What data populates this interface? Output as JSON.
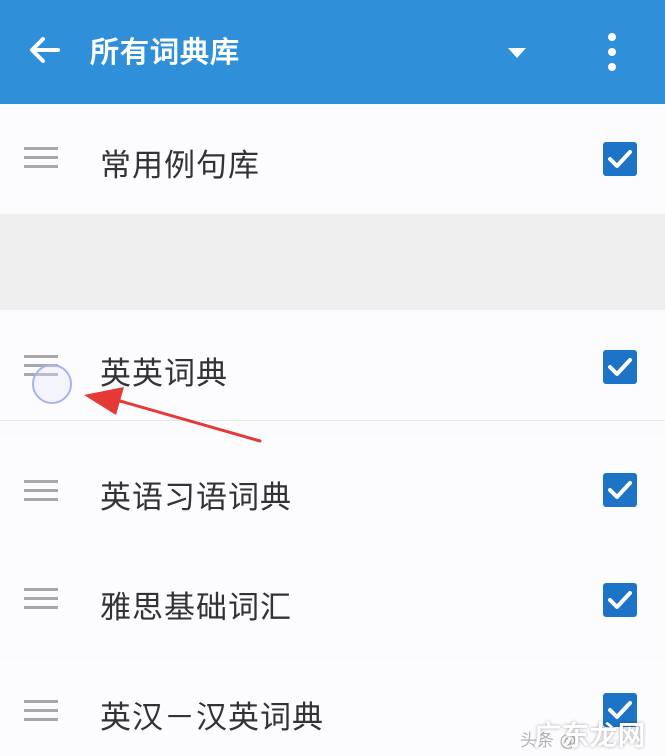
{
  "appbar": {
    "title": "所有词典库",
    "back_icon": "arrow-left-icon",
    "dropdown_icon": "caret-down-icon",
    "more_icon": "more-vertical-icon",
    "color": "#2f8fd9"
  },
  "list": {
    "items": [
      {
        "label": "常用例句库",
        "checked": true
      },
      {
        "label": "英英词典",
        "checked": true
      },
      {
        "label": "英语习语词典",
        "checked": true
      },
      {
        "label": "雅思基础词汇",
        "checked": true
      },
      {
        "label": "英汉－汉英词典",
        "checked": true
      }
    ],
    "checkbox_color": "#1d74c6"
  },
  "annotation": {
    "arrow_color": "#e53935"
  },
  "watermark": {
    "faint_text": "头条 @",
    "main_text": "广东龙网"
  }
}
